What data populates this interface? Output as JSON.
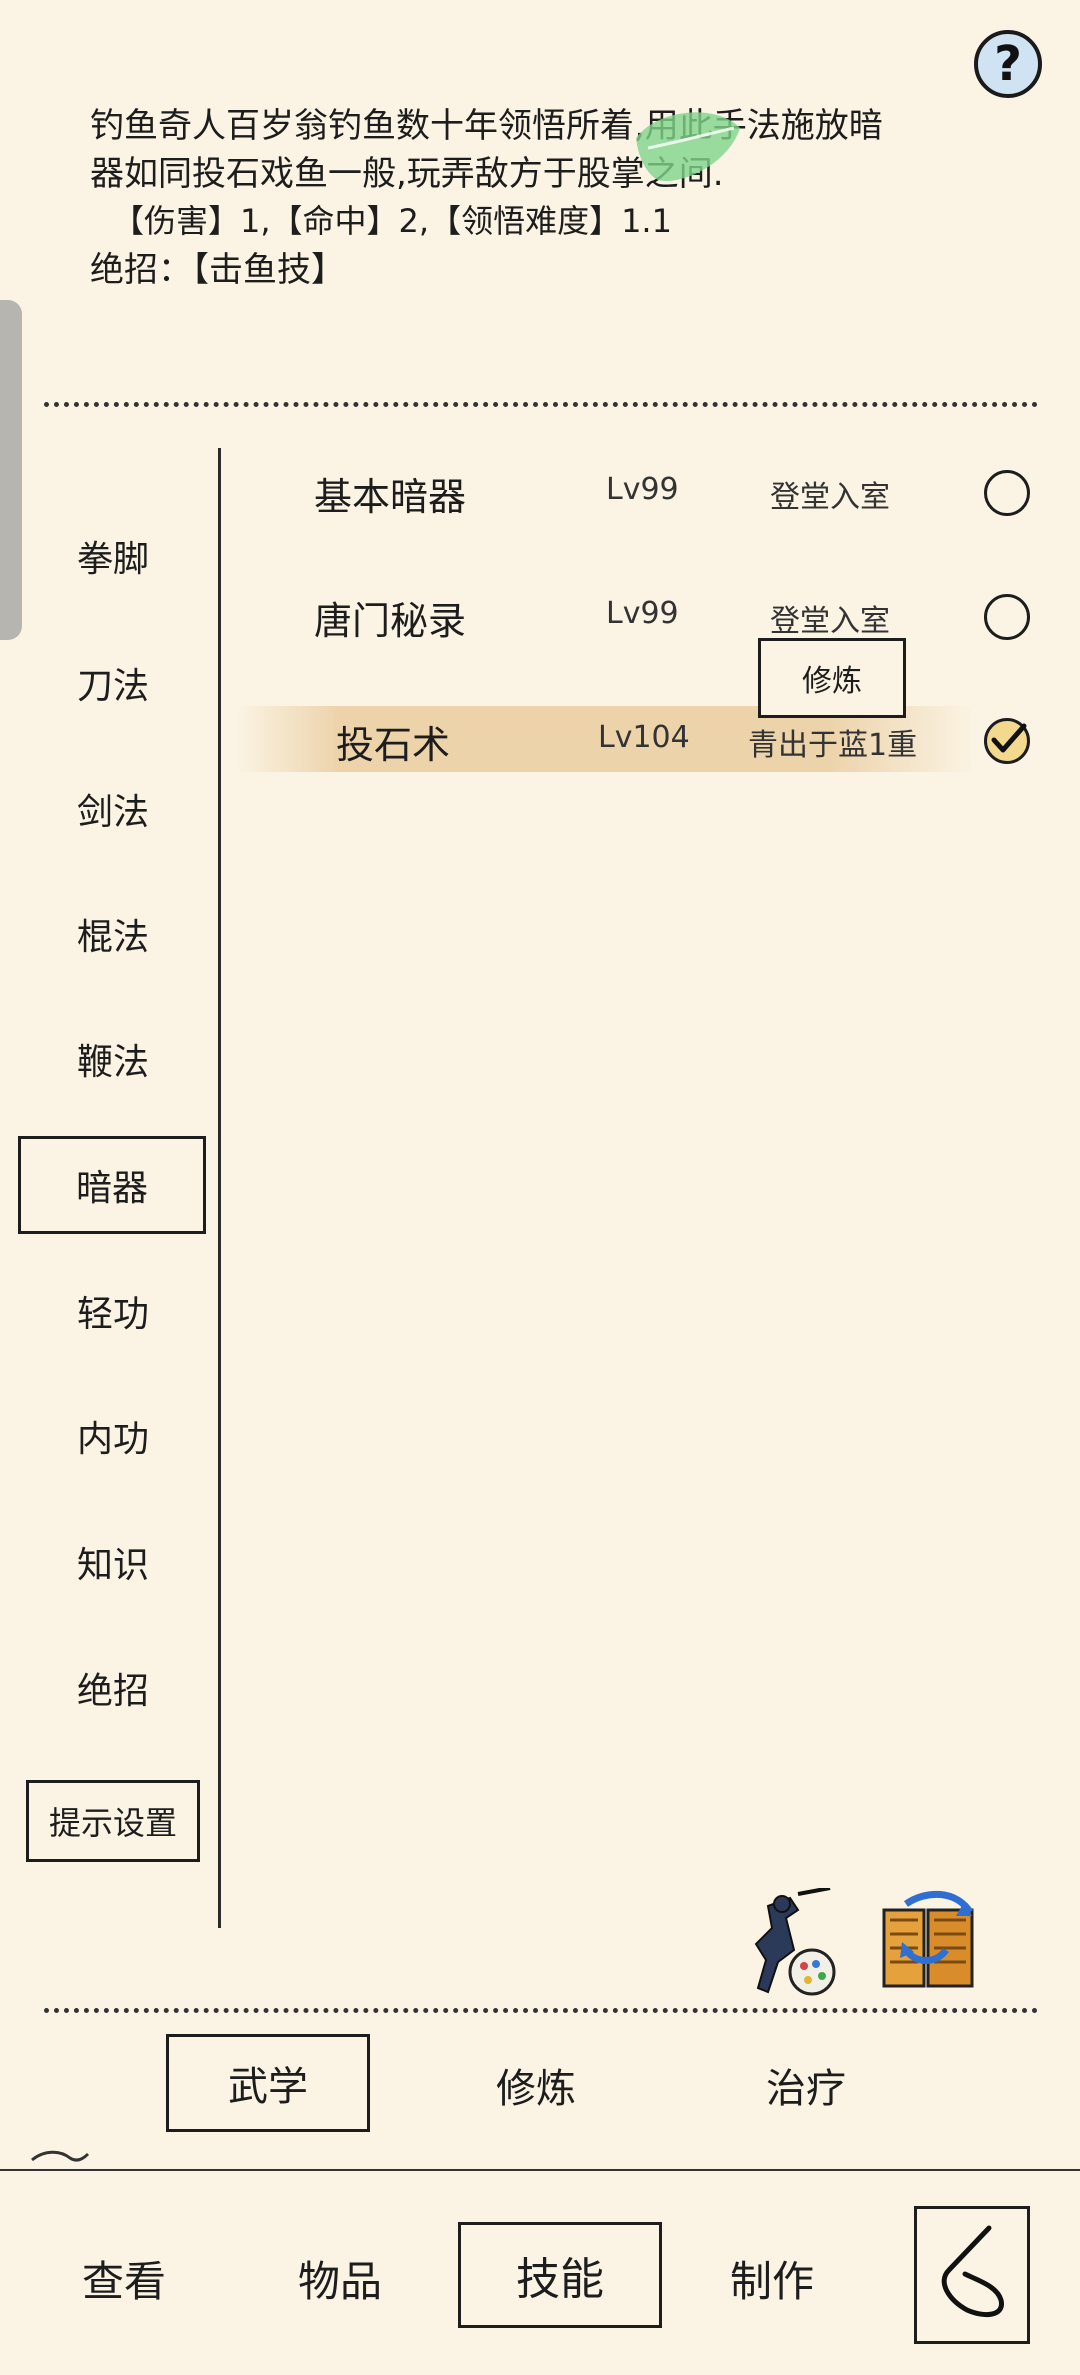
{
  "description": {
    "line1": "钓鱼奇人百岁翁钓鱼数十年领悟所着,用此手法施放暗",
    "line2": "器如同投石戏鱼一般,玩弄敌方于股掌之间.",
    "stats": "【伤害】1,【命中】2,【领悟难度】1.1",
    "ultimate": "绝招：【击鱼技】"
  },
  "help_icon": "question-mark-icon",
  "categories": [
    "拳脚",
    "刀法",
    "剑法",
    "棍法",
    "鞭法",
    "暗器",
    "轻功",
    "内功",
    "知识",
    "绝招"
  ],
  "selected_category": "暗器",
  "hint_settings_label": "提示设置",
  "skills": [
    {
      "name": "基本暗器",
      "level": "Lv99",
      "stage": "登堂入室",
      "checked": false
    },
    {
      "name": "唐门秘录",
      "level": "Lv99",
      "stage": "登堂入室",
      "checked": false
    },
    {
      "name": "投石术",
      "level": "Lv104",
      "stage": "青出于蓝1重",
      "checked": true
    }
  ],
  "practice_popup_label": "修炼",
  "subtabs": {
    "wuxue": "武学",
    "xiulian": "修炼",
    "zhiliao": "治疗"
  },
  "nav": {
    "view": "查看",
    "items": "物品",
    "skills": "技能",
    "craft": "制作"
  },
  "colors": {
    "background": "#fbf4e4",
    "highlight": "#eacda0",
    "help_icon_fill": "#cfe3f3",
    "leaf_green": "#7fd48a"
  }
}
